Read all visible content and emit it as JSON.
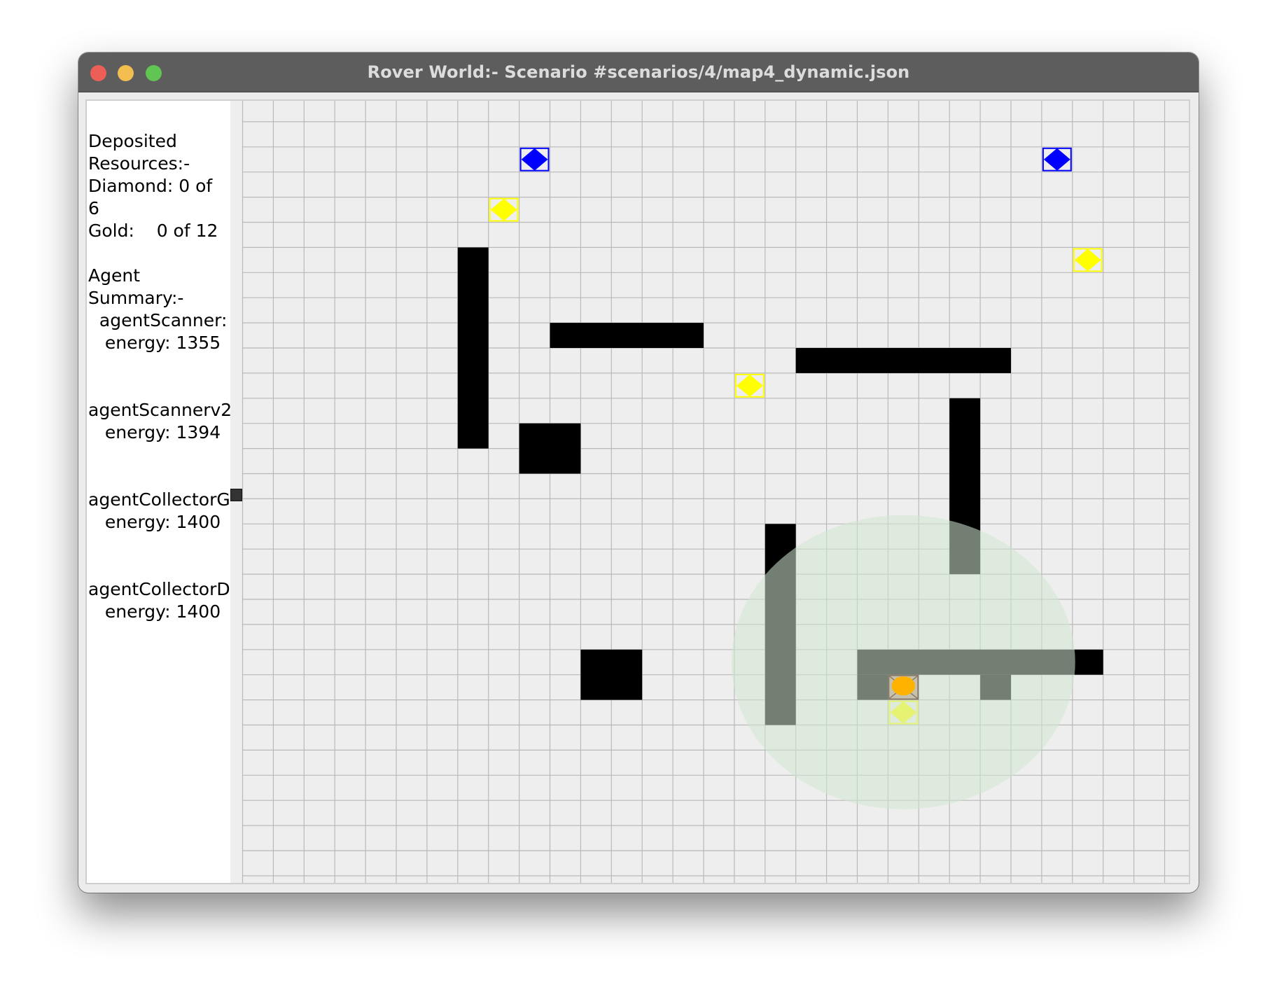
{
  "window": {
    "title": "Rover World:- Scenario #scenarios/4/map4_dynamic.json"
  },
  "sidebar": {
    "deposited_lines": [
      "Deposited",
      "Resources:-",
      "Diamond: 0 of",
      "6",
      "Gold:    0 of 12"
    ],
    "agent_summary_lines": [
      "Agent",
      "Summary:-"
    ],
    "agents": [
      {
        "name": "  agentScanner:",
        "energy": "   energy: 1355"
      },
      {
        "name": "agentScannerv2:",
        "energy": "   energy: 1394"
      },
      {
        "name": "agentCollectorG",
        "energy": "   energy: 1400"
      },
      {
        "name": "agentCollectorD",
        "energy": "   energy: 1400"
      }
    ]
  },
  "world": {
    "columns": 31,
    "rows": 31,
    "colors": {
      "background": "#eeeeee",
      "grid_line": "#b9b9b9",
      "obstacle": "#000000",
      "diamond": "#0000ff",
      "gold": "#ffff00",
      "rover": "#ffb300",
      "scan_area": "#cfe8cf"
    },
    "obstacles": [
      {
        "col": 7,
        "row": 6,
        "w": 1,
        "h": 8
      },
      {
        "col": 10,
        "row": 9,
        "w": 5,
        "h": 1
      },
      {
        "col": 9,
        "row": 13,
        "w": 2,
        "h": 2
      },
      {
        "col": 18,
        "row": 10,
        "w": 7,
        "h": 1
      },
      {
        "col": 23,
        "row": 12,
        "w": 1,
        "h": 7
      },
      {
        "col": 17,
        "row": 17,
        "w": 1,
        "h": 8
      },
      {
        "col": 11,
        "row": 22,
        "w": 2,
        "h": 2
      },
      {
        "col": 20,
        "row": 22,
        "w": 8,
        "h": 1
      },
      {
        "col": 20,
        "row": 23,
        "w": 1,
        "h": 1
      },
      {
        "col": 24,
        "row": 23,
        "w": 1,
        "h": 1
      }
    ],
    "diamonds": [
      {
        "col": 9,
        "row": 2
      },
      {
        "col": 26,
        "row": 2
      }
    ],
    "gold": [
      {
        "col": 8,
        "row": 4
      },
      {
        "col": 27,
        "row": 6
      },
      {
        "col": 16,
        "row": 11
      },
      {
        "col": 21,
        "row": 24
      }
    ],
    "rover": {
      "col": 21,
      "row": 23
    },
    "scan_area": {
      "center_col": 21.5,
      "center_row": 22.5,
      "radius_cells": 6.5
    }
  }
}
